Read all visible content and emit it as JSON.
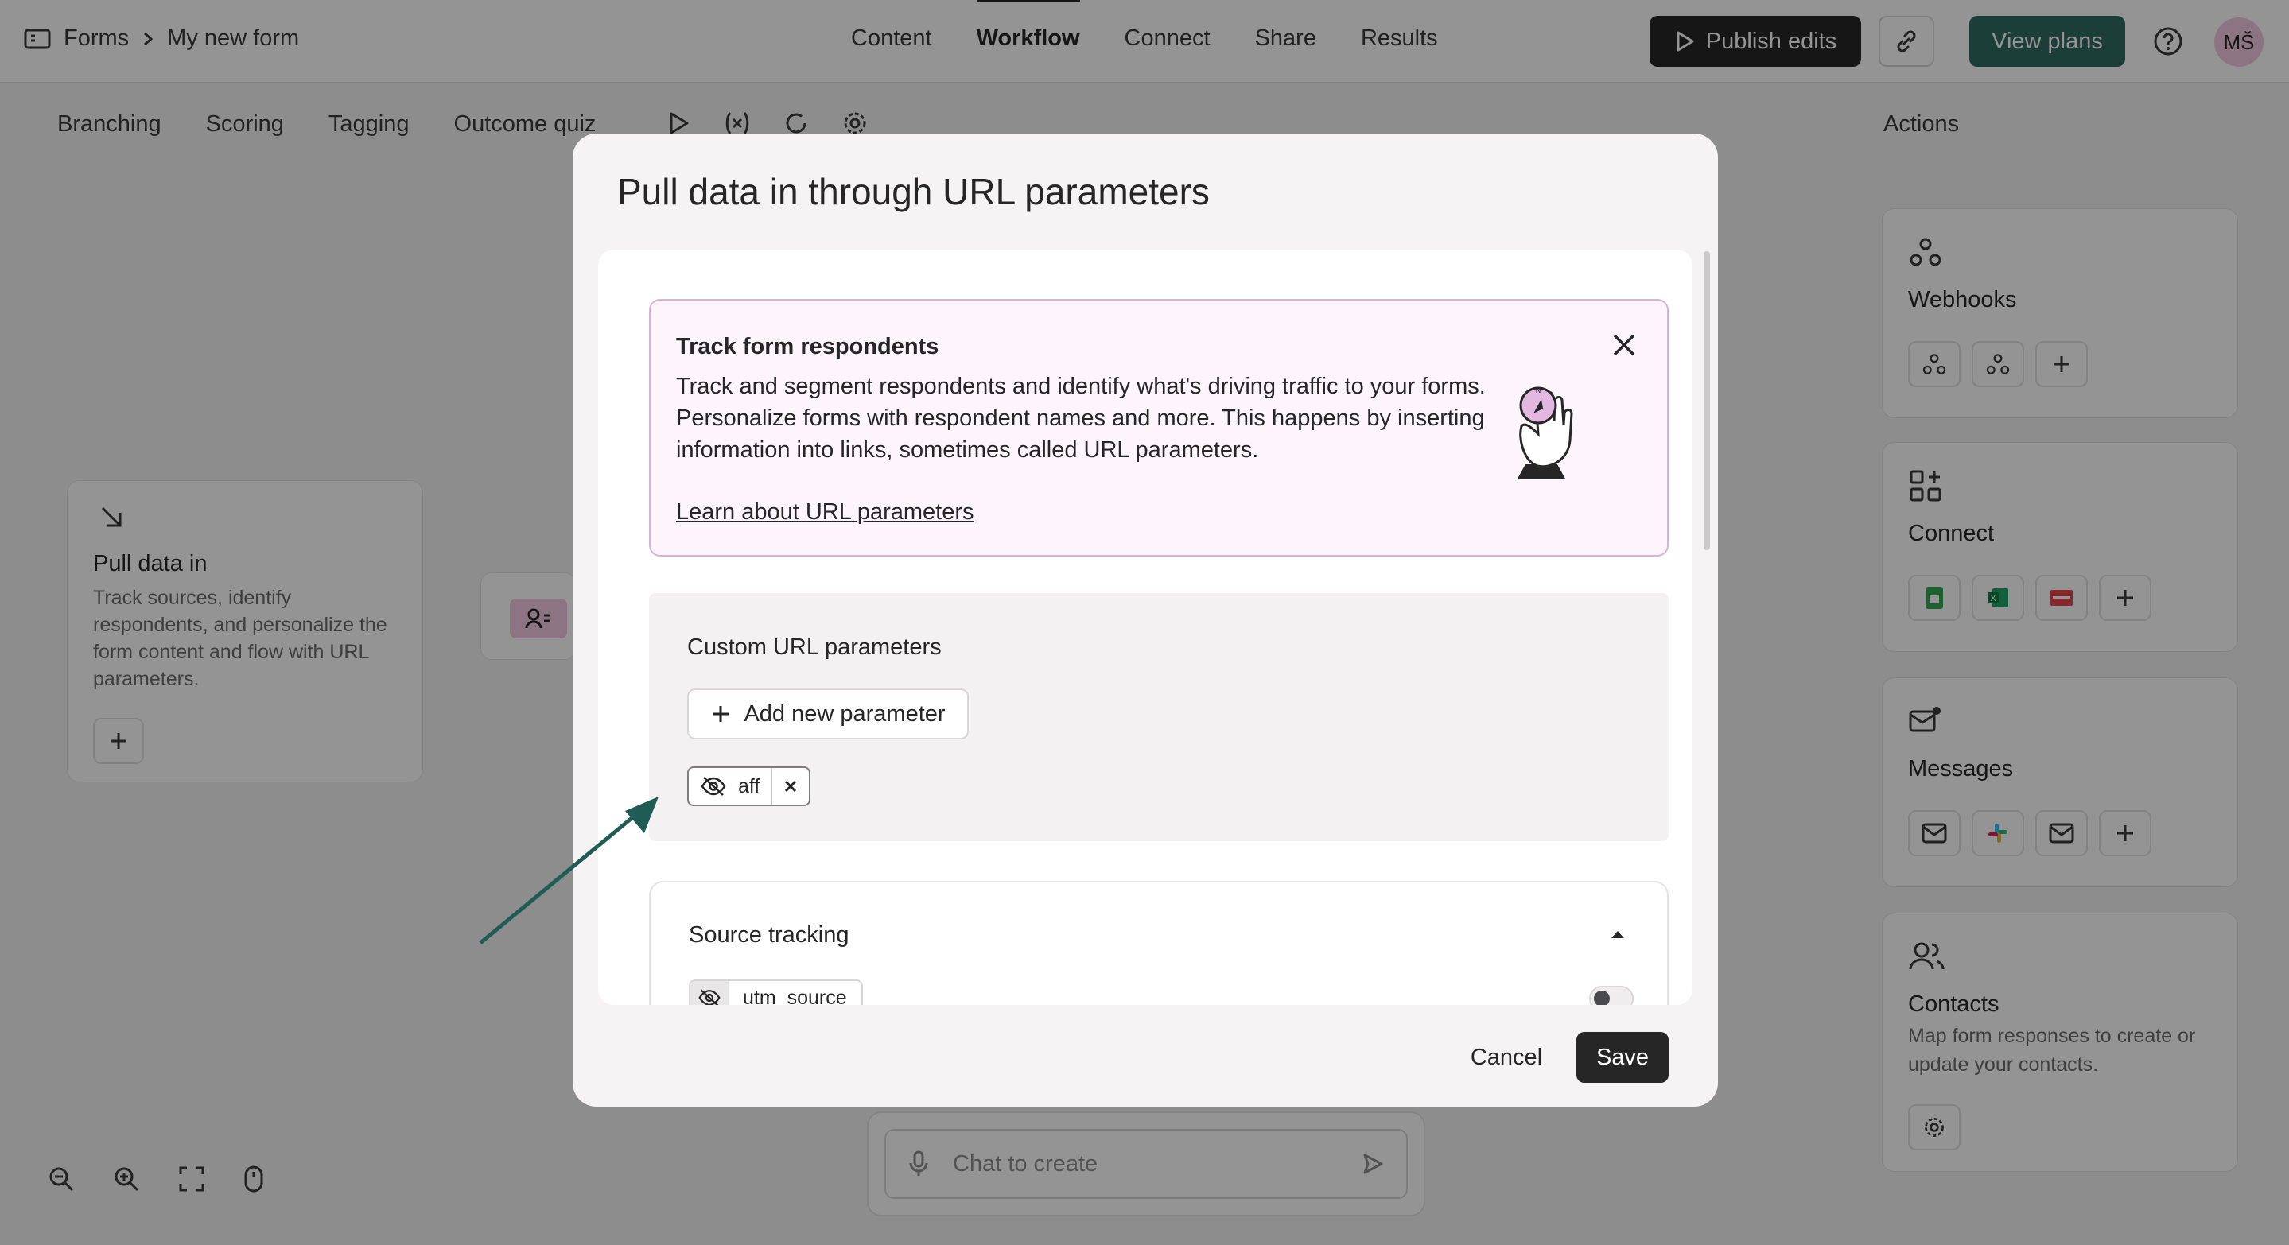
{
  "breadcrumb": {
    "root": "Forms",
    "current": "My new form"
  },
  "nav": {
    "tabs": [
      "Content",
      "Workflow",
      "Connect",
      "Share",
      "Results"
    ],
    "active": "Workflow"
  },
  "header": {
    "publish_label": "Publish edits",
    "plans_label": "View plans",
    "avatar_initials": "MŠ"
  },
  "workflow": {
    "subtabs": [
      "Branching",
      "Scoring",
      "Tagging",
      "Outcome quiz"
    ],
    "actions_title": "Actions",
    "pull_card": {
      "title": "Pull data in",
      "description": "Track sources, identify respondents, and personalize the form content and flow with URL parameters."
    },
    "chat_placeholder": "Chat to create"
  },
  "actions": {
    "webhooks": {
      "title": "Webhooks"
    },
    "connect": {
      "title": "Connect"
    },
    "messages": {
      "title": "Messages"
    },
    "contacts": {
      "title": "Contacts",
      "description": "Map form responses to create or update your contacts."
    }
  },
  "modal": {
    "title": "Pull data in through URL parameters",
    "info": {
      "title": "Track form respondents",
      "text": "Track and segment respondents and identify what's driving traffic to your forms. Personalize forms with respondent names and more. This happens by inserting information into links, sometimes called URL parameters.",
      "link": "Learn about URL parameters"
    },
    "custom": {
      "title": "Custom URL parameters",
      "add_label": "Add new parameter",
      "parameters": [
        "aff"
      ]
    },
    "source": {
      "title": "Source tracking",
      "items": [
        {
          "name": "utm_source",
          "enabled": false
        }
      ]
    },
    "cancel_label": "Cancel",
    "save_label": "Save"
  },
  "colors": {
    "brand_dark": "#262627",
    "plans_green": "#2f6b63",
    "info_border": "#d9b3d2",
    "arrow": "#1f5c54"
  }
}
